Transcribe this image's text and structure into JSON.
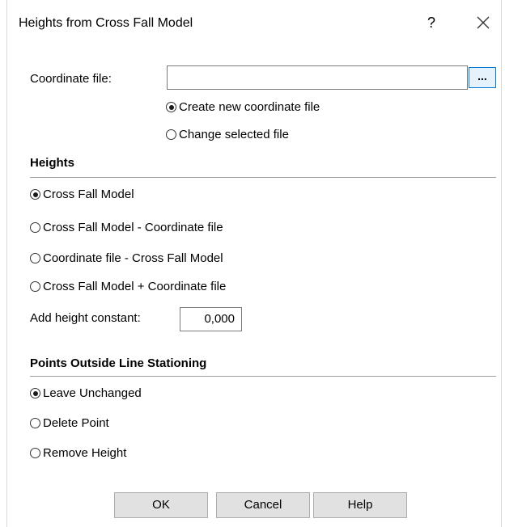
{
  "window": {
    "title": "Heights from Cross Fall Model",
    "help_glyph": "?",
    "close_icon": "close-icon"
  },
  "coordinate_file": {
    "label": "Coordinate file:",
    "value": "",
    "browse_label": "...",
    "options": [
      {
        "label": "Create new coordinate file",
        "checked": true
      },
      {
        "label": "Change selected file",
        "checked": false
      }
    ]
  },
  "heights": {
    "header": "Heights",
    "options": [
      {
        "label": "Cross Fall Model",
        "checked": true
      },
      {
        "label": "Cross Fall Model - Coordinate file",
        "checked": false
      },
      {
        "label": "Coordinate file - Cross Fall Model",
        "checked": false
      },
      {
        "label": "Cross Fall Model + Coordinate file",
        "checked": false
      }
    ],
    "constant_label": "Add height constant:",
    "constant_value": "0,000"
  },
  "outside": {
    "header": "Points Outside Line Stationing",
    "options": [
      {
        "label": "Leave Unchanged",
        "checked": true
      },
      {
        "label": "Delete Point",
        "checked": false
      },
      {
        "label": "Remove Height",
        "checked": false
      }
    ]
  },
  "buttons": {
    "ok": "OK",
    "cancel": "Cancel",
    "help": "Help"
  }
}
